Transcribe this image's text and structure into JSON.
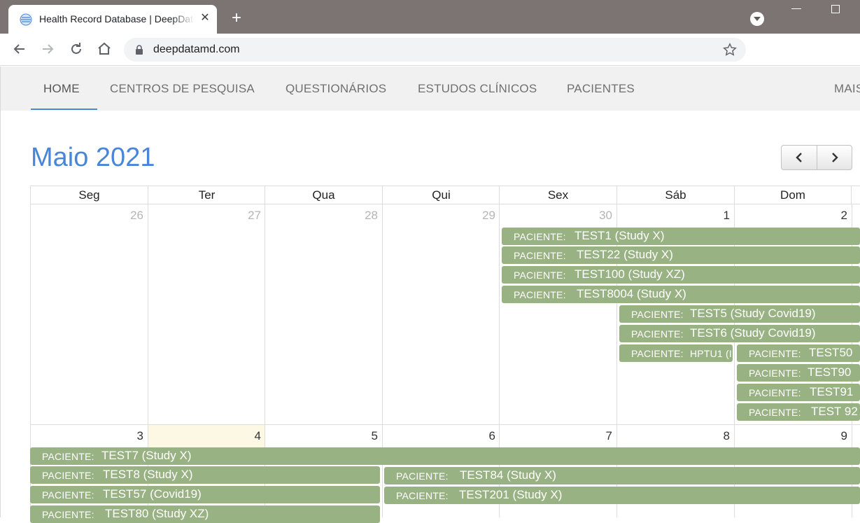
{
  "browser": {
    "tab_title": "Health Record Database | DeepDataMD",
    "url": "deepdatamd.com",
    "icons": [
      "favicon-icon",
      "close-icon",
      "new-tab-icon",
      "profile-dropdown-icon",
      "minimize-icon",
      "maximize-icon",
      "back-icon",
      "forward-icon",
      "reload-icon",
      "home-icon",
      "lock-icon",
      "bookmark-star-icon"
    ]
  },
  "nav": {
    "home": "HOME",
    "centros": "CENTROS DE PESQUISA",
    "questionarios": "QUESTIONÁRIOS",
    "estudos": "ESTUDOS CLÍNICOS",
    "pacientes": "PACIENTES",
    "mais": "MAIS",
    "active": "HOME"
  },
  "calendar": {
    "title": "Maio 2021",
    "weekdays": [
      "Seg",
      "Ter",
      "Qua",
      "Qui",
      "Sex",
      "Sáb",
      "Dom"
    ],
    "week1_days": [
      "26",
      "27",
      "28",
      "29",
      "30",
      "1",
      "2"
    ],
    "week2_days": [
      "3",
      "4",
      "5",
      "6",
      "7",
      "8",
      "9"
    ],
    "today": "4",
    "event_label": "PACIENTE:",
    "events": {
      "e1": "TEST1 (Study X)",
      "e2": "TEST22 (Study X)",
      "e3": "TEST100 (Study XZ)",
      "e4": "TEST8004 (Study X)",
      "e5": "TEST5 (Study Covid19)",
      "e6": "TEST6 (Study Covid19)",
      "e7": "HPTU1 (I",
      "e8": "TEST50",
      "e9": "TEST90",
      "e10": "TEST91",
      "e11": "TEST 92",
      "e12": "TEST7 (Study X)",
      "e13": "TEST8 (Study X)",
      "e14": "TEST84 (Study X)",
      "e15": "TEST57 (Covid19)",
      "e16": "TEST201 (Study X)",
      "e17": "TEST80 (Study XZ)"
    }
  },
  "colors": {
    "event_bg": "#99b283",
    "title_blue": "#4a86d8",
    "today_bg": "#fcf8e3"
  }
}
